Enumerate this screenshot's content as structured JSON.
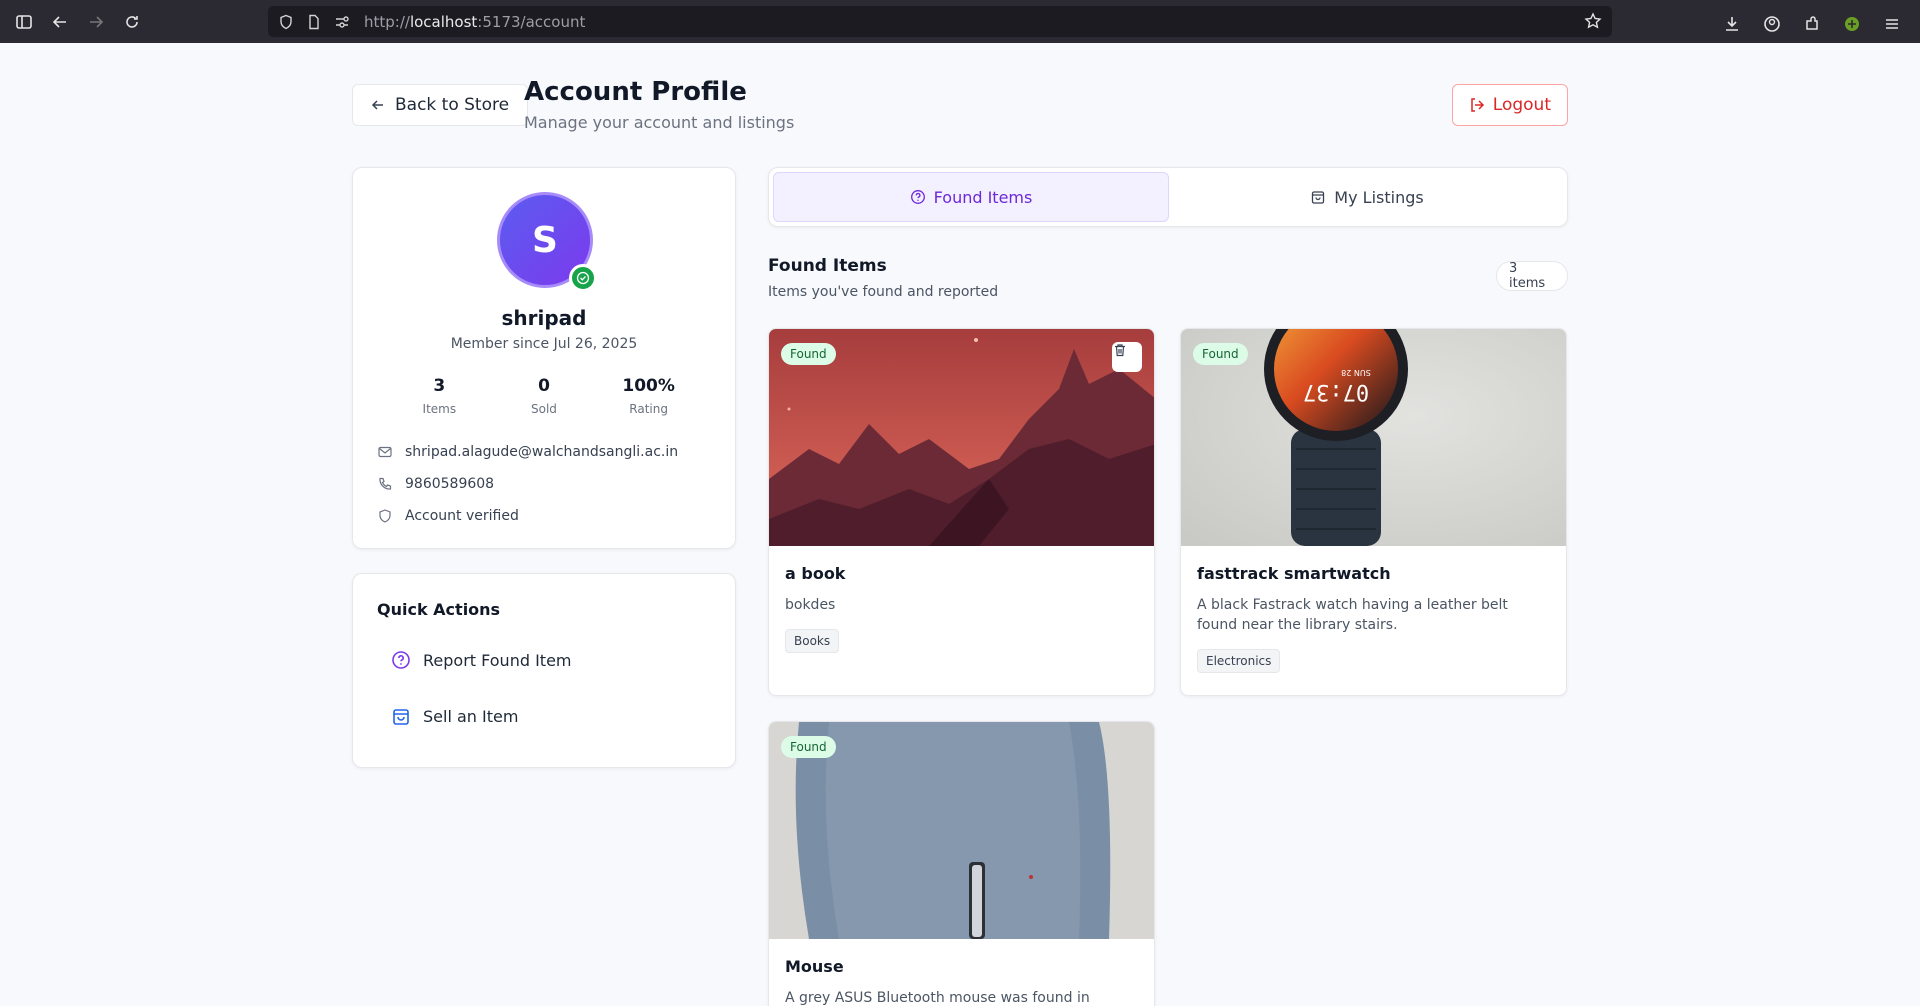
{
  "browser": {
    "url_prefix": "http://",
    "url_host": "localhost",
    "url_rest": ":5173/account"
  },
  "header": {
    "back_label": "Back to Store",
    "title": "Account Profile",
    "subtitle": "Manage your account and listings",
    "logout_label": "Logout"
  },
  "profile": {
    "initial": "S",
    "name": "shripad",
    "member_since": "Member since Jul 26, 2025",
    "stats": [
      {
        "value": "3",
        "label": "Items"
      },
      {
        "value": "0",
        "label": "Sold"
      },
      {
        "value": "100%",
        "label": "Rating"
      }
    ],
    "email": "shripad.alagude@walchandsangli.ac.in",
    "phone": "9860589608",
    "verified": "Account verified"
  },
  "quick_actions": {
    "title": "Quick Actions",
    "items": [
      {
        "label": "Report Found Item",
        "icon": "help-circle-icon"
      },
      {
        "label": "Sell an Item",
        "icon": "shopping-bag-icon"
      }
    ]
  },
  "tabs": [
    {
      "label": "Found Items",
      "active": true
    },
    {
      "label": "My Listings",
      "active": false
    }
  ],
  "section": {
    "title": "Found Items",
    "subtitle": "Items you've found and reported",
    "count": "3 items"
  },
  "items": [
    {
      "badge": "Found",
      "title": "a book",
      "description": "bokdes",
      "category": "Books"
    },
    {
      "badge": "Found",
      "title": "fasttrack smartwatch",
      "description": "A black Fastrack watch having a leather belt found near the library stairs.",
      "category": "Electronics",
      "watch_time": "07:37",
      "watch_date": "SUN 28"
    },
    {
      "badge": "Found",
      "title": "Mouse",
      "description": "A grey ASUS Bluetooth mouse was found in central CCF"
    }
  ],
  "colors": {
    "accent": "#6d28d9",
    "danger": "#dc2626",
    "success": "#16a34a"
  }
}
